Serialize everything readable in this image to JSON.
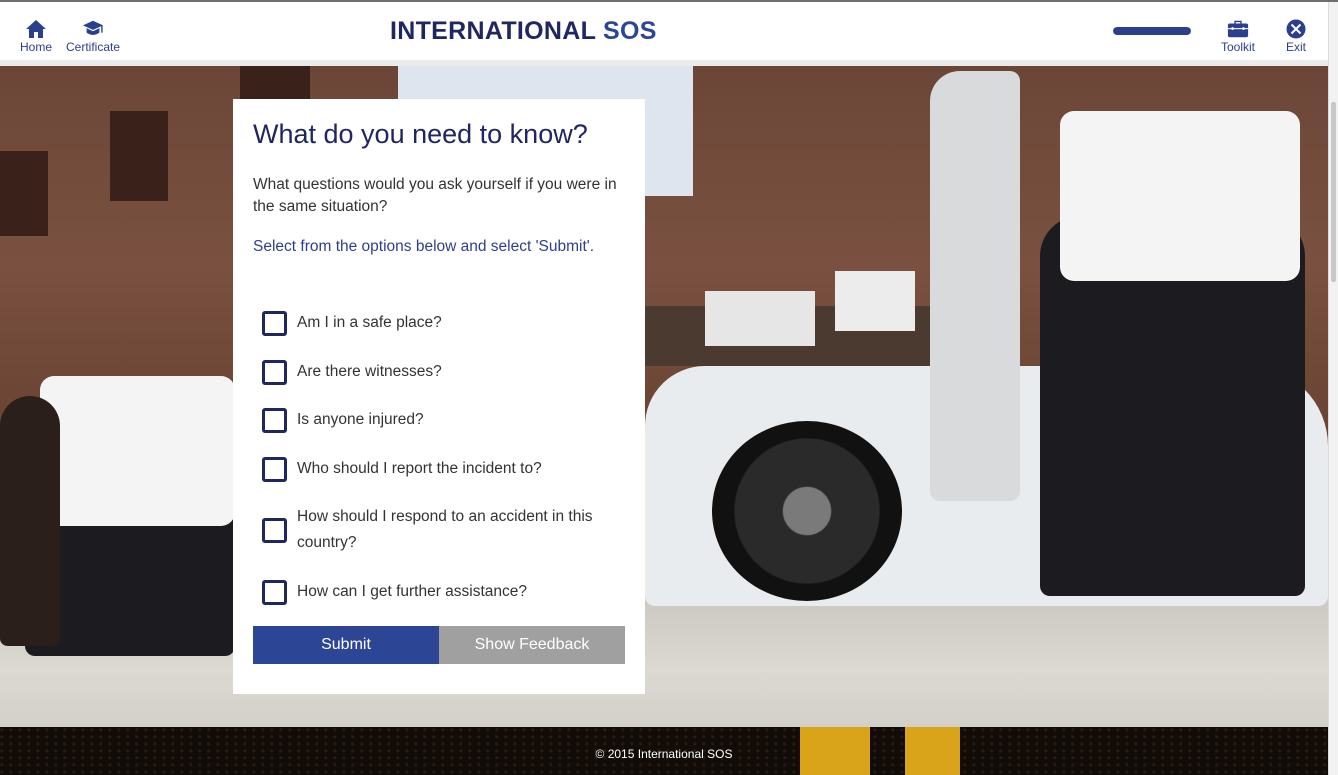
{
  "header": {
    "nav_left": [
      {
        "label": "Home",
        "icon": "home-icon"
      },
      {
        "label": "Certificate",
        "icon": "graduation-cap-icon"
      }
    ],
    "logo": {
      "primary": "INTERNATIONAL",
      "secondary": "SOS"
    },
    "progress": {
      "percent": 100
    },
    "nav_right": [
      {
        "label": "Toolkit",
        "icon": "briefcase-icon"
      },
      {
        "label": "Exit",
        "icon": "close-circle-icon"
      }
    ]
  },
  "panel": {
    "title": "What do you need to know?",
    "prompt": "What questions would you ask yourself if you were in the same situation?",
    "instruction": "Select from the options below and select 'Submit'.",
    "options": [
      {
        "label": "Am I in a safe place?",
        "checked": false
      },
      {
        "label": "Are there witnesses?",
        "checked": false
      },
      {
        "label": "Is anyone injured?",
        "checked": false
      },
      {
        "label": "Who should I report the incident to?",
        "checked": false
      },
      {
        "label": "How should I respond to an accident in this country?",
        "checked": false
      },
      {
        "label": "How can I get further assistance?",
        "checked": false
      }
    ],
    "submit_label": "Submit",
    "feedback_label": "Show Feedback"
  },
  "footer": {
    "copyright": "© 2015 International SOS"
  },
  "colors": {
    "brand_dark": "#1f2660",
    "brand_blue": "#2c4594",
    "button_gray": "#a0a0a0"
  }
}
